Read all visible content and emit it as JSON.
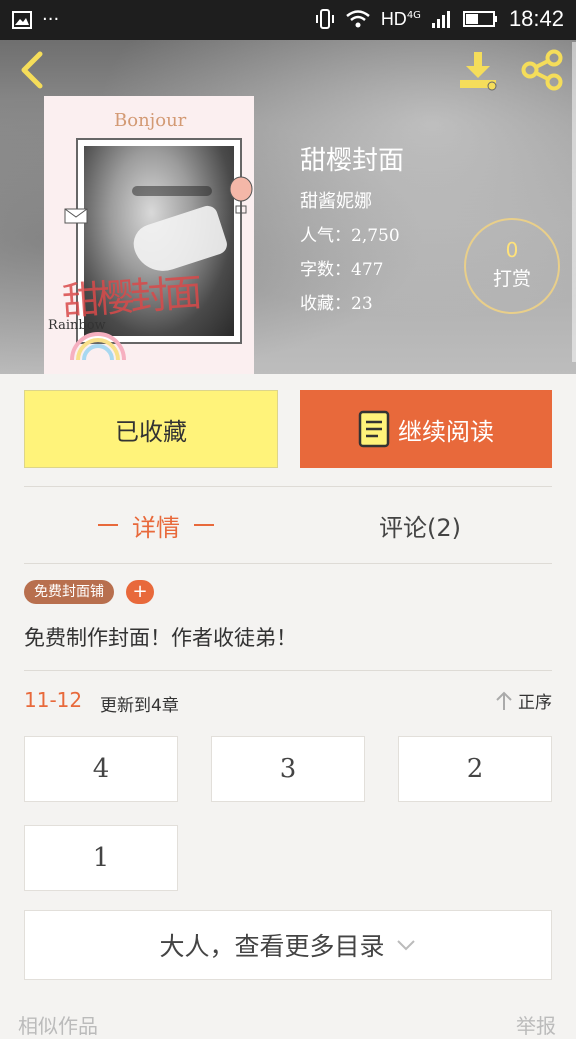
{
  "status_bar": {
    "network": "HD",
    "signal_label": "4G",
    "time": "18:42",
    "dots": "···"
  },
  "book": {
    "title": "甜樱封面",
    "author": "甜酱妮娜",
    "popularity": "人气：2,750",
    "word_count": "字数：477",
    "favorites": "收藏：23",
    "cover_text_top": "Bonjour",
    "cover_text_bottom": "Rainbow",
    "cover_title_art": "甜樱封面"
  },
  "reward": {
    "count": "0",
    "label": "打赏"
  },
  "actions": {
    "collect_label": "已收藏",
    "read_label": "继续阅读"
  },
  "tabs": [
    {
      "label": "详情",
      "active": true
    },
    {
      "label": "评论(2)",
      "active": false
    }
  ],
  "tag": {
    "label": "免费封面铺",
    "add_symbol": "+"
  },
  "summary": "免费制作封面！作者收徒弟！",
  "update": {
    "date": "11-12",
    "text": "更新到4章"
  },
  "sort": {
    "label": "正序"
  },
  "chapters": [
    "4",
    "3",
    "2",
    "1"
  ],
  "more_toc_label": "大人，查看更多目录",
  "bottom": {
    "left": "相似作品",
    "right": "举报"
  },
  "colors": {
    "accent": "#e8693b",
    "collect_yellow": "#fff37a",
    "icon_yellow": "#f5dd5a"
  }
}
